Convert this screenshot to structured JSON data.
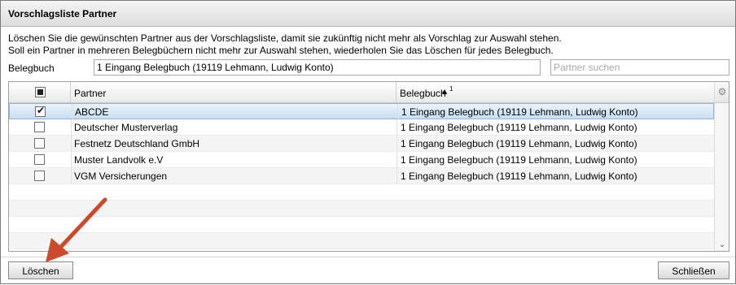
{
  "dialog": {
    "title": "Vorschlagsliste Partner",
    "desc_line1": "Löschen Sie die gewünschten Partner aus der Vorschlagsliste, damit sie zukünftig nicht mehr als Vorschlag zur Auswahl stehen.",
    "desc_line2": "Soll ein Partner in mehreren Belegbüchern nicht mehr zur Auswahl stehen, wiederholen Sie das Löschen für jedes Belegbuch."
  },
  "filter": {
    "belegbuch_label": "Belegbuch",
    "belegbuch_value": "1 Eingang Belegbuch   (19119 Lehmann, Ludwig Konto)",
    "search_placeholder": "Partner suchen"
  },
  "grid": {
    "columns": {
      "partner": "Partner",
      "belegbuch": "Belegbuch",
      "sort_index": "1"
    },
    "rows": [
      {
        "partner": "ABCDE",
        "belegbuch": "1 Eingang Belegbuch   (19119 Lehmann, Ludwig Konto)",
        "checked": true
      },
      {
        "partner": "Deutscher Musterverlag",
        "belegbuch": "1 Eingang Belegbuch   (19119 Lehmann, Ludwig Konto)",
        "checked": false
      },
      {
        "partner": "Festnetz Deutschland GmbH",
        "belegbuch": "1 Eingang Belegbuch   (19119 Lehmann, Ludwig Konto)",
        "checked": false
      },
      {
        "partner": "Muster Landvolk e.V",
        "belegbuch": "1 Eingang Belegbuch   (19119 Lehmann, Ludwig Konto)",
        "checked": false
      },
      {
        "partner": "VGM Versicherungen",
        "belegbuch": "1 Eingang Belegbuch   (19119 Lehmann, Ludwig Konto)",
        "checked": false
      }
    ]
  },
  "buttons": {
    "delete": "Löschen",
    "close": "Schließen"
  },
  "annotation": {
    "arrow_color": "#c94a2c"
  }
}
